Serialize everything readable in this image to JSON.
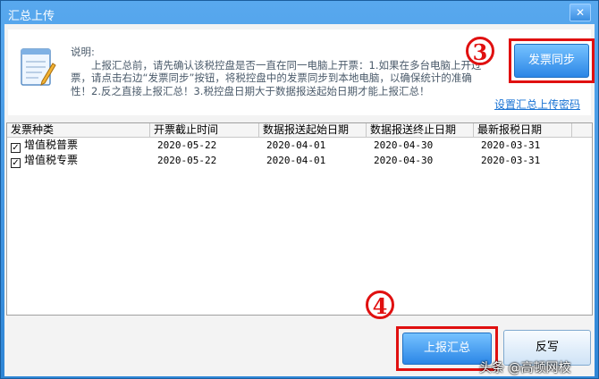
{
  "window": {
    "title": "汇总上传",
    "close_glyph": "✕"
  },
  "info": {
    "title": "说明:",
    "body": "上报汇总前，请先确认该税控盘是否一直在同一电脑上开票：1.如果在多台电脑上开过票，请点击右边“发票同步”按钮，将税控盘中的发票同步到本地电脑，以确保统计的准确性！2.反之直接上报汇总！3.税控盘日期大于数据报送起始日期才能上报汇总！"
  },
  "buttons": {
    "sync": "发票同步",
    "set_password": "设置汇总上传密码",
    "upload": "上报汇总",
    "cancel": "反写"
  },
  "markers": {
    "step3": "3",
    "step4": "4"
  },
  "table": {
    "headers": [
      "发票种类",
      "开票截止时间",
      "数据报送起始日期",
      "数据报送终止日期",
      "最新报税日期"
    ],
    "rows": [
      {
        "checked": true,
        "check_glyph": "✓",
        "cells": [
          "增值税普票",
          "2020-05-22",
          "2020-04-01",
          "2020-04-30",
          "2020-03-31"
        ]
      },
      {
        "checked": true,
        "check_glyph": "✓",
        "cells": [
          "增值税专票",
          "2020-05-22",
          "2020-04-01",
          "2020-04-30",
          "2020-03-31"
        ]
      }
    ]
  },
  "watermark": "头条 @高顿网校",
  "colors": {
    "title_bar": "#2f86d6",
    "button_blue": "#2b86e6",
    "highlight_red": "#e01010",
    "link": "#1a73d4"
  }
}
